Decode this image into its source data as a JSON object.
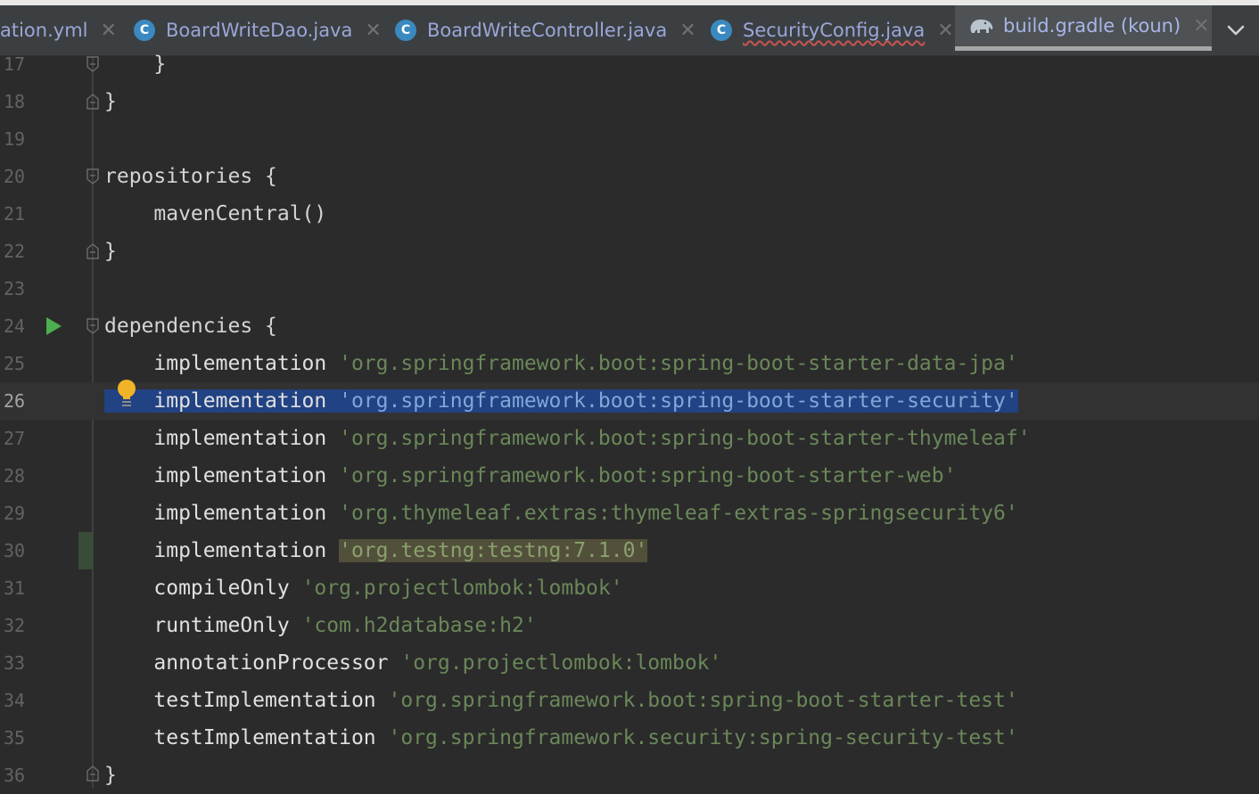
{
  "tabs": [
    {
      "label": "ation.yml",
      "icon": "yaml-file-icon",
      "active": false
    },
    {
      "label": "BoardWriteDao.java",
      "icon": "class-c-icon",
      "active": false
    },
    {
      "label": "BoardWriteController.java",
      "icon": "class-c-icon",
      "active": false
    },
    {
      "label": "SecurityConfig.java",
      "icon": "class-c-icon",
      "active": false,
      "warning": true
    },
    {
      "label": "build.gradle (koun)",
      "icon": "gradle-elephant-icon",
      "active": true
    }
  ],
  "editor": {
    "current_line": 26,
    "lines": [
      {
        "num": "17",
        "code": "    }"
      },
      {
        "num": "18",
        "code": "}"
      },
      {
        "num": "19",
        "code": ""
      },
      {
        "num": "20",
        "code": "repositories {"
      },
      {
        "num": "21",
        "code": "    mavenCentral()"
      },
      {
        "num": "22",
        "code": "}"
      },
      {
        "num": "23",
        "code": ""
      },
      {
        "num": "24",
        "code": "dependencies {"
      },
      {
        "num": "25",
        "kw": "    implementation ",
        "str": "'org.springframework.boot:spring-boot-starter-data-jpa'"
      },
      {
        "num": "26",
        "kw": "    implementation ",
        "str": "'org.springframework.boot:spring-boot-starter-security'"
      },
      {
        "num": "27",
        "kw": "    implementation ",
        "str": "'org.springframework.boot:spring-boot-starter-thymeleaf'"
      },
      {
        "num": "28",
        "kw": "    implementation ",
        "str": "'org.springframework.boot:spring-boot-starter-web'"
      },
      {
        "num": "29",
        "kw": "    implementation ",
        "str": "'org.thymeleaf.extras:thymeleaf-extras-springsecurity6'"
      },
      {
        "num": "30",
        "kw": "    implementation ",
        "str": "'org.testng:testng:7.1.0'"
      },
      {
        "num": "31",
        "kw": "    compileOnly ",
        "str": "'org.projectlombok:lombok'"
      },
      {
        "num": "32",
        "kw": "    runtimeOnly ",
        "str": "'com.h2database:h2'"
      },
      {
        "num": "33",
        "kw": "    annotationProcessor ",
        "str": "'org.projectlombok:lombok'"
      },
      {
        "num": "34",
        "kw": "    testImplementation ",
        "str": "'org.springframework.boot:spring-boot-starter-test'"
      },
      {
        "num": "35",
        "kw": "    testImplementation ",
        "str": "'org.springframework.security:spring-security-test'"
      },
      {
        "num": "36",
        "code": "}"
      }
    ]
  },
  "colors": {
    "background": "#2b2b2b",
    "string": "#6a8759",
    "selection": "#214283",
    "highlight": "#52503a",
    "run_icon": "#4caf50",
    "bulb": "#f0b429"
  }
}
